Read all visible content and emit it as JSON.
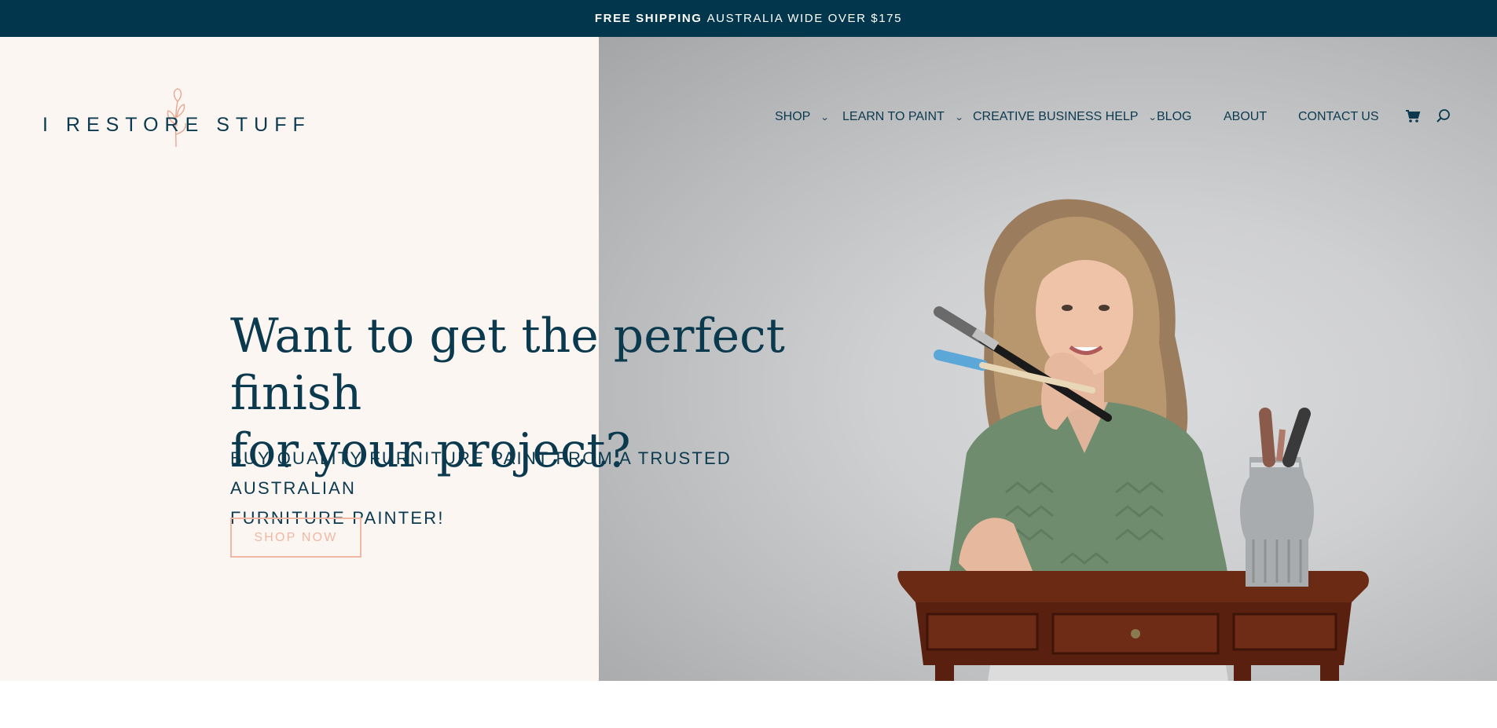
{
  "topbar": {
    "strong": "FREE SHIPPING",
    "text": "AUSTRALIA WIDE OVER $175"
  },
  "logo": {
    "text": "I RESTORE STUFF",
    "icon": "flower-sprig-icon"
  },
  "nav": {
    "items": [
      {
        "label": "SHOP",
        "dropdown": true
      },
      {
        "label": "LEARN TO PAINT",
        "dropdown": true
      },
      {
        "label": "CREATIVE BUSINESS HELP",
        "dropdown": true
      },
      {
        "label": "BLOG",
        "dropdown": false
      },
      {
        "label": "ABOUT",
        "dropdown": false
      },
      {
        "label": "CONTACT US",
        "dropdown": false
      }
    ],
    "cart_icon": "cart-icon",
    "search_icon": "search-icon"
  },
  "hero": {
    "headline_line1": "Want to get the perfect finish",
    "headline_line2": "for your project?",
    "subhead_line1": "BUY QUALITY FURNITURE PAINT FROM A TRUSTED AUSTRALIAN",
    "subhead_line2": "FURNITURE PAINTER!",
    "cta_label": "SHOP NOW"
  },
  "colors": {
    "topbar_bg": "#02364d",
    "brand_navy": "#0b3a4f",
    "left_panel": "#fcf6f3",
    "cta_accent": "#f0b8a4"
  }
}
